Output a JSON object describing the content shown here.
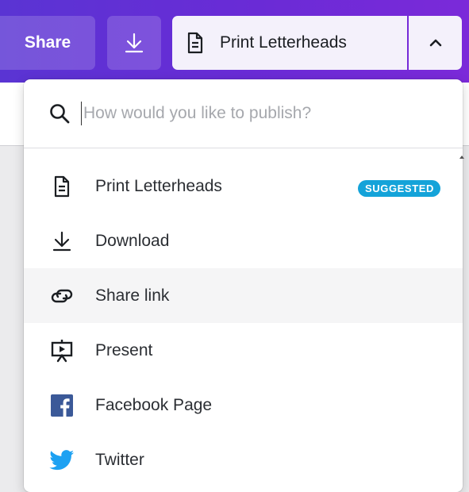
{
  "toolbar": {
    "share_label": "Share",
    "download_icon": "download-icon",
    "publish_label": "Print Letterheads",
    "publish_icon": "document-icon",
    "toggle_icon": "chevron-up-icon"
  },
  "search": {
    "placeholder": "How would you like to publish?",
    "value": "",
    "icon": "search-icon"
  },
  "menu": {
    "items": [
      {
        "label": "Print Letterheads",
        "icon": "document-icon",
        "badge": "SUGGESTED"
      },
      {
        "label": "Download",
        "icon": "download-icon"
      },
      {
        "label": "Share link",
        "icon": "link-icon"
      },
      {
        "label": "Present",
        "icon": "present-icon"
      },
      {
        "label": "Facebook Page",
        "icon": "facebook-icon"
      },
      {
        "label": "Twitter",
        "icon": "twitter-icon"
      }
    ]
  },
  "colors": {
    "toolbar_start": "#5a34d3",
    "toolbar_end": "#7b2ad9",
    "badge": "#14a3d9",
    "facebook": "#3b5998",
    "twitter": "#1da1f2"
  }
}
